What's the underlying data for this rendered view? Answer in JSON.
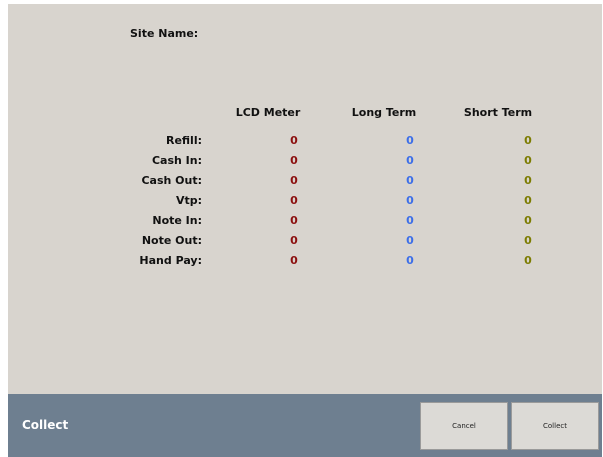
{
  "site": {
    "label": "Site Name:",
    "value": ""
  },
  "colors": {
    "lcd": "#8b0e0e",
    "long": "#3c6ee8",
    "short": "#7c7c00"
  },
  "columns": {
    "lcd": "LCD Meter",
    "long": "Long Term",
    "short": "Short Term"
  },
  "rows": [
    {
      "label": "Refill:",
      "lcd": "0",
      "long": "0",
      "short": "0"
    },
    {
      "label": "Cash In:",
      "lcd": "0",
      "long": "0",
      "short": "0"
    },
    {
      "label": "Cash Out:",
      "lcd": "0",
      "long": "0",
      "short": "0"
    },
    {
      "label": "Vtp:",
      "lcd": "0",
      "long": "0",
      "short": "0"
    },
    {
      "label": "Note In:",
      "lcd": "0",
      "long": "0",
      "short": "0"
    },
    {
      "label": "Note Out:",
      "lcd": "0",
      "long": "0",
      "short": "0"
    },
    {
      "label": "Hand Pay:",
      "lcd": "0",
      "long": "0",
      "short": "0"
    }
  ],
  "footer": {
    "title": "Collect",
    "cancel_label": "Cancel",
    "collect_label": "Collect"
  }
}
